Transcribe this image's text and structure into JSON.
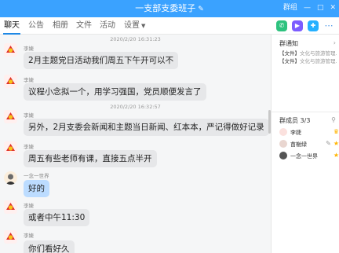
{
  "window": {
    "title": "一支部支委班子",
    "min_label": "—",
    "max_label": "□",
    "close_label": "✕",
    "extra_label": "群组"
  },
  "tabs": [
    {
      "label": "聊天"
    },
    {
      "label": "公告"
    },
    {
      "label": "相册"
    },
    {
      "label": "文件"
    },
    {
      "label": "活动"
    },
    {
      "label": "设置"
    }
  ],
  "chat": {
    "messages": [
      {
        "timestamp": "2020/2/20 16:31:23",
        "sender": "李婕",
        "text": "2月主题党日活动我们周五下午开可以不"
      },
      {
        "sender": "李婕",
        "text": "议程小念拟一个，用学习强国，党员顺便发言了"
      },
      {
        "timestamp": "2020/2/20 16:32:57",
        "sender": "李婕",
        "text": "另外，2月支委会新闻和主题当日新闻、红本本，严记得做好记录"
      },
      {
        "sender": "李婕",
        "text": "周五有些老师有课，直接五点半开"
      },
      {
        "sender": "一念一世界",
        "text": "好的"
      },
      {
        "sender": "李婕",
        "text": "或者中午11:30"
      },
      {
        "sender": "李婕",
        "text": "你们看好久"
      }
    ]
  },
  "side": {
    "notice_title": "群通知",
    "notices": [
      {
        "tag": "【文件】",
        "text": "文化与旅游管理..."
      },
      {
        "tag": "【文件】",
        "text": "文化与旅游管理..."
      }
    ],
    "members_title": "群成员 3/3",
    "members": [
      {
        "name": "李婕"
      },
      {
        "name": "苗榭绿"
      },
      {
        "name": "一念一世界"
      }
    ]
  },
  "colors": {
    "titlebar": "#3aa2ff",
    "bubble": "#e6e7e9",
    "bubble_self": "#bcdcff",
    "accent": "#1e88e5"
  }
}
